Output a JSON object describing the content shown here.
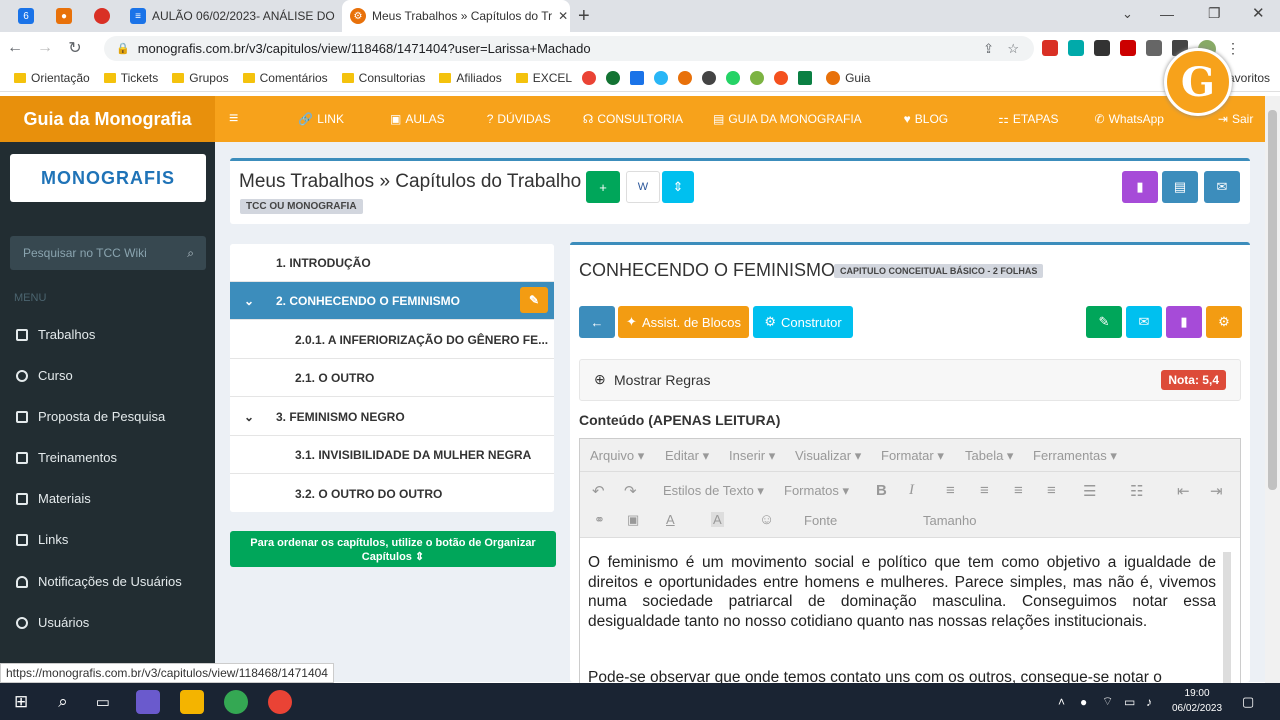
{
  "browser": {
    "tabs": [
      {
        "label": "",
        "icon": "6",
        "color": "#1a73e8"
      },
      {
        "label": "",
        "icon": "•",
        "color": "#e8710a"
      },
      {
        "label": "",
        "icon": "●",
        "color": "#d93025"
      },
      {
        "label": "AULÃO 06/02/2023- ANÁLISE DO",
        "icon": "≡",
        "color": "#1a73e8"
      },
      {
        "label": "Meus Trabalhos » Capítulos do Tr",
        "icon": "⚙",
        "color": "#e8710a"
      }
    ],
    "url": "monografis.com.br/v3/capitulos/view/118468/1471404?user=Larissa+Machado",
    "bookmarks": [
      "Orientação",
      "Tickets",
      "Grupos",
      "Comentários",
      "Consultorias",
      "Afiliados",
      "EXCEL"
    ],
    "bookmark_guia": "Guia",
    "bookmark_more": "avoritos"
  },
  "topnav": {
    "brand": "Guia da Monografia",
    "links": [
      "LINK",
      "AULAS",
      "DÚVIDAS",
      "CONSULTORIA",
      "GUIA DA MONOGRAFIA",
      "BLOG",
      "ETAPAS",
      "WhatsApp"
    ],
    "logout": "Sair"
  },
  "sidebar": {
    "logo": "MONOGRAFIS",
    "search_placeholder": "Pesquisar no TCC Wiki",
    "menu_header": "MENU",
    "items": [
      "Trabalhos",
      "Curso",
      "Proposta de Pesquisa",
      "Treinamentos",
      "Materiais",
      "Links",
      "Notificações de Usuários",
      "Usuários"
    ]
  },
  "header": {
    "title": "Meus Trabalhos » Capítulos do Trabalho",
    "badge": "TCC OU MONOGRAFIA"
  },
  "chapters": [
    {
      "label": "1. INTRODUÇÃO",
      "level": 0,
      "active": false
    },
    {
      "label": "2. CONHECENDO O FEMINISMO",
      "level": 0,
      "active": true
    },
    {
      "label": "2.0.1. A INFERIORIZAÇÃO DO GÊNERO FE...",
      "level": 1,
      "active": false
    },
    {
      "label": "2.1. O OUTRO",
      "level": 1,
      "active": false
    },
    {
      "label": "3. FEMINISMO NEGRO",
      "level": 0,
      "active": false
    },
    {
      "label": "3.1. INVISIBILIDADE DA MULHER NEGRA",
      "level": 1,
      "active": false
    },
    {
      "label": "3.2. O OUTRO DO OUTRO",
      "level": 1,
      "active": false
    }
  ],
  "order_note": "Para ordenar os capítulos, utilize o botão de Organizar Capítulos",
  "chapter": {
    "title": "CONHECENDO O FEMINISMO",
    "type_badge": "CAPITULO CONCEITUAL BÁSICO - 2 FOLHAS",
    "assist_label": "Assist. de Blocos",
    "builder_label": "Construtor",
    "rules_label": "Mostrar Regras",
    "grade": "Nota: 5,4",
    "content_label": "Conteúdo (APENAS LEITURA)",
    "menus": [
      "Arquivo",
      "Editar",
      "Inserir",
      "Visualizar",
      "Formatar",
      "Tabela",
      "Ferramentas"
    ],
    "text_styles": "Estilos de Texto",
    "formats": "Formatos",
    "font": "Fonte",
    "size": "Tamanho",
    "paragraph1": "O feminismo é um movimento social e político que tem como objetivo a igualdade de direitos e oportunidades entre homens e mulheres. Parece simples, mas não é, vivemos numa sociedade patriarcal de dominação masculina. Conseguimos notar essa desigualdade tanto no nosso cotidiano quanto nas nossas relações institucionais.",
    "paragraph2": "Pode-se observar que onde temos contato uns com os outros, consegue-se notar o"
  },
  "status_url": "https://monografis.com.br/v3/capitulos/view/118468/1471404",
  "clock": {
    "time": "19:00",
    "date": "06/02/2023"
  },
  "colors": {
    "orange": "#f7a21b",
    "blue": "#3c8dbc",
    "green": "#00a65a",
    "purple": "#a64bd8",
    "aqua": "#00c0ef",
    "red": "#dd4b39",
    "dark": "#222d32"
  }
}
